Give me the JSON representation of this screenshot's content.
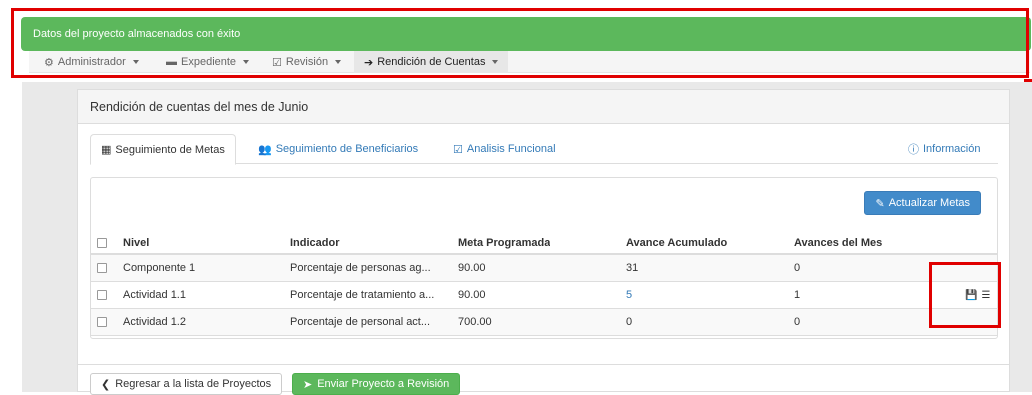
{
  "alert": {
    "message": "Datos del proyecto almacenados con éxito",
    "color": "#5cb85c"
  },
  "navbar": {
    "items": [
      {
        "label": "Administrador",
        "icon": "gear-icon"
      },
      {
        "label": "Expediente",
        "icon": "folder-icon"
      },
      {
        "label": "Revisión",
        "icon": "edit-icon"
      },
      {
        "label": "Rendición de Cuentas",
        "icon": "arrow-right-icon",
        "active": true
      }
    ]
  },
  "panel": {
    "title": "Rendición de cuentas del mes de Junio",
    "tabs": [
      {
        "label": "Seguimiento de Metas",
        "icon": "calendar-icon",
        "active": true
      },
      {
        "label": "Seguimiento de Beneficiarios",
        "icon": "users-icon"
      },
      {
        "label": "Analisis Funcional",
        "icon": "check-square-icon"
      },
      {
        "label": "Información",
        "icon": "info-icon"
      }
    ],
    "update_button": "Actualizar Metas"
  },
  "table": {
    "columns": [
      "Nivel",
      "Indicador",
      "Meta Programada",
      "Avance Acumulado",
      "Avances del Mes"
    ],
    "rows": [
      {
        "nivel": "Componente 1",
        "indicador": "Porcentaje de personas ag...",
        "meta": "90.00",
        "acumulado": "31",
        "mes": "0"
      },
      {
        "nivel": "Actividad 1.1",
        "indicador": "Porcentaje de tratamiento a...",
        "meta": "90.00",
        "acumulado": "5",
        "mes": "1"
      },
      {
        "nivel": "Actividad 1.2",
        "indicador": "Porcentaje de personal act...",
        "meta": "700.00",
        "acumulado": "0",
        "mes": "0"
      }
    ],
    "row_icons": [
      "save-icon",
      "list-icon"
    ]
  },
  "footer": {
    "back_button": "Regresar a la lista de Proyectos",
    "send_button": "Enviar Proyecto a Revisión"
  }
}
